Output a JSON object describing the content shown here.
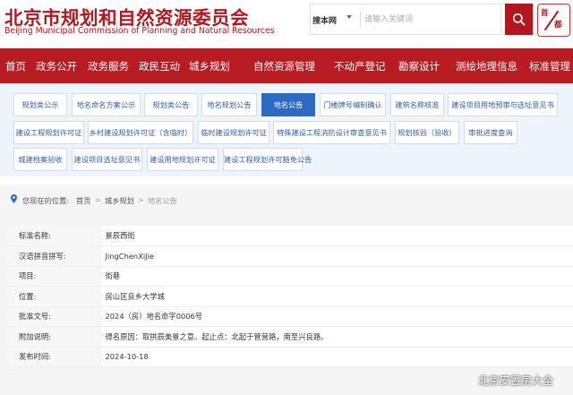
{
  "header": {
    "title": "北京市规划和自然资源委员会",
    "subtitle": "Beijing Municipal Commission of Planning and Natural Resources",
    "search_scope": "搜本网",
    "search_placeholder": "请输入关键词",
    "logo_text_a": "首",
    "logo_text_b": "都"
  },
  "nav": {
    "items": [
      "首页",
      "政务公开",
      "政务服务",
      "政民互动",
      "城乡规划",
      "自然资源管理",
      "不动产登记",
      "勘察设计",
      "测绘地理信息",
      "标准管理"
    ]
  },
  "subnav": {
    "items": [
      "规划类公示",
      "地名命名方案公示",
      "规划类公告",
      "地名规划公告",
      "地名公告",
      "门楼牌号编制确认",
      "建筑名称核准",
      "建设项目用地预审与选址意见书",
      "建设工程规划许可证",
      "乡村建设规划许可证（含临时）",
      "临时建设规划许可证",
      "特殊建设工程消防设计审查意见书",
      "规划核验（验收）",
      "审批进度查询",
      "城建档案验收",
      "建设项目选址意见书",
      "建设用地规划许可证",
      "建设工程规划许可豁免公告"
    ],
    "active_index": 4
  },
  "breadcrumb": {
    "prefix": "您现在的位置:",
    "items": [
      "首页",
      "城乡规划",
      "地名公告"
    ]
  },
  "info": {
    "rows": [
      {
        "label": "标准名称:",
        "value": "景辰西街"
      },
      {
        "label": "汉语拼音拼写:",
        "value": "JingChenXiJie"
      },
      {
        "label": "项目:",
        "value": "街巷"
      },
      {
        "label": "位置:",
        "value": "房山区良乡大学城"
      },
      {
        "label": "批准文号:",
        "value": "2024（房）地名命字0006号"
      },
      {
        "label": "附加说明:",
        "value": "得名原因：取拱辰美景之意。起止点：北起于管营路，南至兴良路。"
      },
      {
        "label": "发布时间:",
        "value": "2024-10-18"
      }
    ]
  },
  "watermark": "北京安置房大全",
  "colors": {
    "brand": "#b81c23",
    "accent": "#2b6bc4",
    "chip_text": "#2d5fa8"
  }
}
